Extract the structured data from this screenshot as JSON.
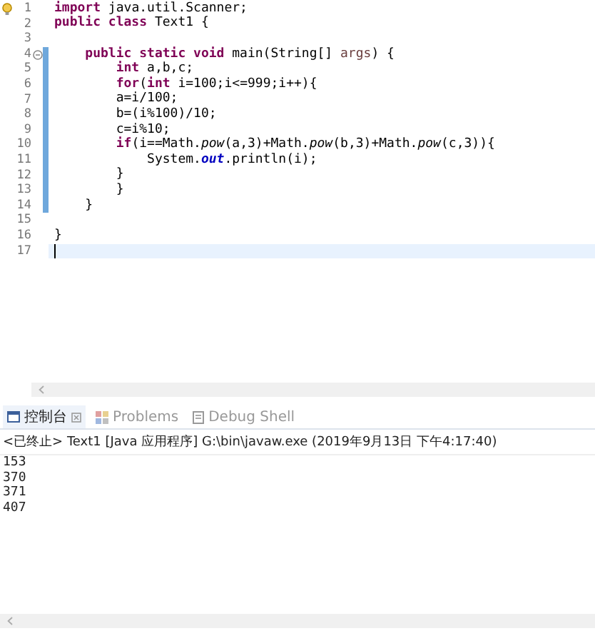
{
  "editor": {
    "lines": [
      {
        "number": "1",
        "warning": true,
        "collapsible": false,
        "changed": false,
        "current": false,
        "tokens": [
          {
            "text": "import",
            "kind": "keyword"
          },
          {
            "text": " java.util.Scanner;",
            "kind": "plain"
          }
        ]
      },
      {
        "number": "2",
        "warning": false,
        "collapsible": false,
        "changed": false,
        "current": false,
        "tokens": [
          {
            "text": "public class",
            "kind": "keyword"
          },
          {
            "text": " Text1 {",
            "kind": "plain"
          }
        ]
      },
      {
        "number": "3",
        "warning": false,
        "collapsible": false,
        "changed": false,
        "current": false
      },
      {
        "number": "4",
        "warning": false,
        "collapsible": true,
        "changed": true,
        "current": false,
        "tokens": [
          {
            "text": "    public static void",
            "kind": "keyword"
          },
          {
            "text": " main(String[] ",
            "kind": "plain"
          },
          {
            "text": "args",
            "kind": "param"
          },
          {
            "text": ") {",
            "kind": "plain"
          }
        ]
      },
      {
        "number": "5",
        "warning": false,
        "collapsible": false,
        "changed": true,
        "current": false,
        "tokens": [
          {
            "text": "        int",
            "kind": "keyword"
          },
          {
            "text": " a,b,c;",
            "kind": "plain"
          }
        ]
      },
      {
        "number": "6",
        "warning": false,
        "collapsible": false,
        "changed": true,
        "current": false,
        "tokens": [
          {
            "text": "        for",
            "kind": "keyword"
          },
          {
            "text": "(",
            "kind": "plain"
          },
          {
            "text": "int",
            "kind": "keyword"
          },
          {
            "text": " i=100;i<=999;i++){",
            "kind": "plain"
          }
        ]
      },
      {
        "number": "7",
        "warning": false,
        "collapsible": false,
        "changed": true,
        "current": false,
        "tokens": [
          {
            "text": "        a=i/100;",
            "kind": "plain"
          }
        ]
      },
      {
        "number": "8",
        "warning": false,
        "collapsible": false,
        "changed": true,
        "current": false,
        "tokens": [
          {
            "text": "        b=(i%100)/10;",
            "kind": "plain"
          }
        ]
      },
      {
        "number": "9",
        "warning": false,
        "collapsible": false,
        "changed": true,
        "current": false,
        "tokens": [
          {
            "text": "        c=i%10;",
            "kind": "plain"
          }
        ]
      },
      {
        "number": "10",
        "warning": false,
        "collapsible": false,
        "changed": true,
        "current": false,
        "tokens": [
          {
            "text": "        if",
            "kind": "keyword"
          },
          {
            "text": "(i==Math.",
            "kind": "plain"
          },
          {
            "text": "pow",
            "kind": "method"
          },
          {
            "text": "(a,3)+Math.",
            "kind": "plain"
          },
          {
            "text": "pow",
            "kind": "method"
          },
          {
            "text": "(b,3)+Math.",
            "kind": "plain"
          },
          {
            "text": "pow",
            "kind": "method"
          },
          {
            "text": "(c,3)){",
            "kind": "plain"
          }
        ]
      },
      {
        "number": "11",
        "warning": false,
        "collapsible": false,
        "changed": true,
        "current": false,
        "tokens": [
          {
            "text": "            System.",
            "kind": "plain"
          },
          {
            "text": "out",
            "kind": "field"
          },
          {
            "text": ".println(i);",
            "kind": "plain"
          }
        ]
      },
      {
        "number": "12",
        "warning": false,
        "collapsible": false,
        "changed": true,
        "current": false,
        "tokens": [
          {
            "text": "        }",
            "kind": "plain"
          }
        ]
      },
      {
        "number": "13",
        "warning": false,
        "collapsible": false,
        "changed": true,
        "current": false,
        "tokens": [
          {
            "text": "        }",
            "kind": "plain"
          }
        ]
      },
      {
        "number": "14",
        "warning": false,
        "collapsible": false,
        "changed": true,
        "current": false,
        "tokens": [
          {
            "text": "    }",
            "kind": "plain"
          }
        ]
      },
      {
        "number": "15",
        "warning": false,
        "collapsible": false,
        "changed": false,
        "current": false
      },
      {
        "number": "16",
        "warning": false,
        "collapsible": false,
        "changed": false,
        "current": false,
        "tokens": [
          {
            "text": "}",
            "kind": "plain"
          }
        ]
      },
      {
        "number": "17",
        "warning": false,
        "collapsible": false,
        "changed": false,
        "current": true
      }
    ]
  },
  "tabs": [
    {
      "label": "控制台",
      "kind": "console",
      "selected": true
    },
    {
      "label": "Problems",
      "kind": "problems",
      "selected": false
    },
    {
      "label": "Debug Shell",
      "kind": "debug",
      "selected": false
    }
  ],
  "console": {
    "header": "<已终止> Text1 [Java 应用程序] G:\\bin\\javaw.exe  (2019年9月13日 下午4:17:40)",
    "output": [
      "153",
      "370",
      "371",
      "407"
    ]
  }
}
